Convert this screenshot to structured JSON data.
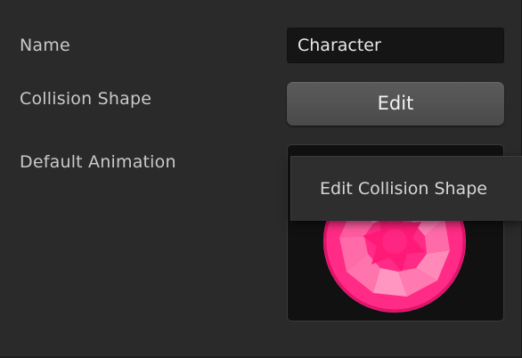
{
  "inspector": {
    "name_label": "Name",
    "name_value": "Character",
    "collision_label": "Collision Shape",
    "edit_button_label": "Edit",
    "default_animation_label": "Default Animation"
  },
  "context_menu": {
    "items": [
      {
        "label": "Edit Collision Shape"
      }
    ]
  },
  "preview": {
    "icon": "pink-gem-sprite",
    "colors": {
      "outer": "#ff2b86",
      "inner": "#ff6aa8",
      "core": "#ff1a78",
      "highlight": "#ff96c2",
      "background": "#111111"
    }
  }
}
